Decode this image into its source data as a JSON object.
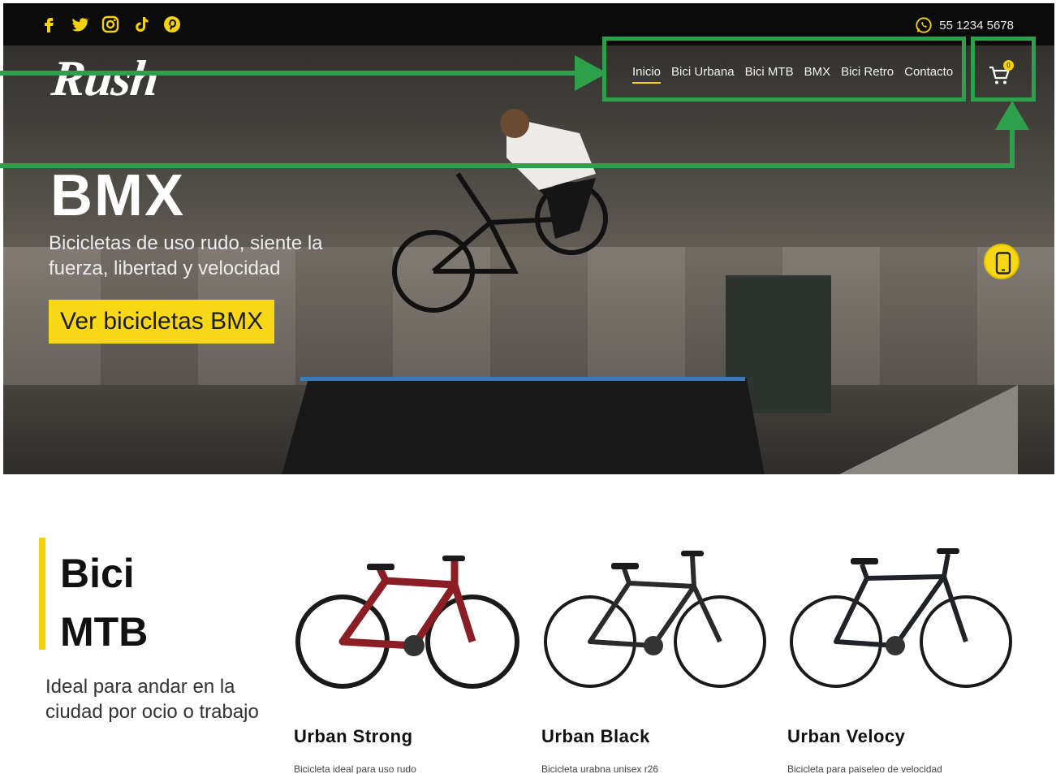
{
  "header": {
    "phone": "55 1234 5678",
    "logo": "Rush",
    "social_icons": [
      "facebook-icon",
      "twitter-icon",
      "instagram-icon",
      "tiktok-icon",
      "pinterest-icon"
    ],
    "nav": [
      {
        "label": "Inicio",
        "active": true
      },
      {
        "label": "Bici Urbana"
      },
      {
        "label": "Bici MTB"
      },
      {
        "label": "BMX"
      },
      {
        "label": "Bici Retro"
      },
      {
        "label": "Contacto"
      }
    ],
    "cart_count": "0"
  },
  "hero": {
    "title": "BMX",
    "subtitle": "Bicicletas de uso rudo, siente la fuerza, libertad y velocidad",
    "cta": "Ver bicicletas BMX"
  },
  "section": {
    "title_line1": "Bici",
    "title_line2": "MTB",
    "description": "Ideal para andar en la ciudad por ocio o trabajo"
  },
  "products": [
    {
      "name": "Urban Strong",
      "desc": "Bicicleta ideal para uso rudo",
      "color": "#8b1e24"
    },
    {
      "name": "Urban Black",
      "desc": "Bicicleta urabna unisex r26",
      "color": "#2a2a2a"
    },
    {
      "name": "Urban Velocy",
      "desc": "Bicicleta para paiseleo de velocidad",
      "color": "#1f2226"
    }
  ],
  "colors": {
    "accent": "#f8d816",
    "annotation": "#2ea04c"
  }
}
